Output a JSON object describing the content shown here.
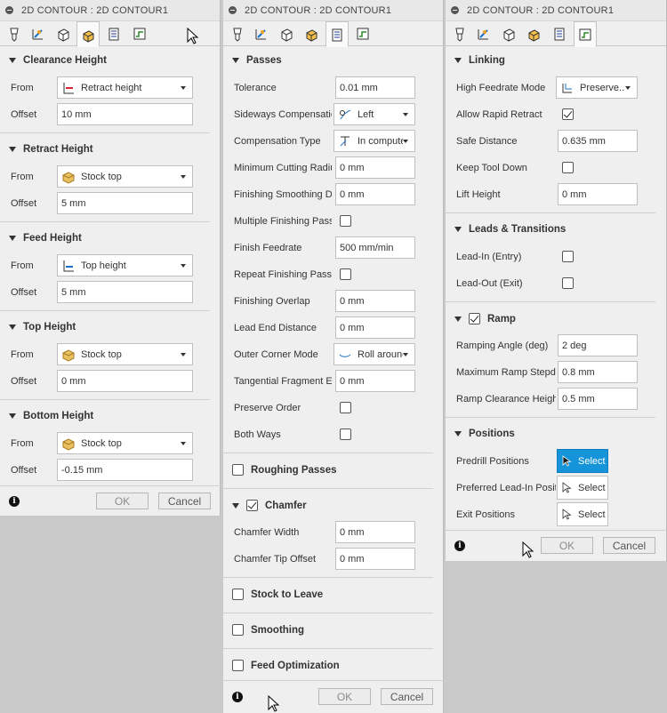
{
  "title": "2D CONTOUR : 2D CONTOUR1",
  "footer": {
    "info": "i",
    "ok": "OK",
    "cancel": "Cancel"
  },
  "panel1": {
    "clearance": {
      "head": "Clearance Height",
      "from_label": "From",
      "from_value": "Retract height",
      "offset_label": "Offset",
      "offset_value": "10 mm"
    },
    "retract": {
      "head": "Retract Height",
      "from_label": "From",
      "from_value": "Stock top",
      "offset_label": "Offset",
      "offset_value": "5 mm"
    },
    "feed": {
      "head": "Feed Height",
      "from_label": "From",
      "from_value": "Top height",
      "offset_label": "Offset",
      "offset_value": "5 mm"
    },
    "top": {
      "head": "Top Height",
      "from_label": "From",
      "from_value": "Stock top",
      "offset_label": "Offset",
      "offset_value": "0 mm"
    },
    "bottom": {
      "head": "Bottom Height",
      "from_label": "From",
      "from_value": "Stock top",
      "offset_label": "Offset",
      "offset_value": "-0.15 mm"
    }
  },
  "panel2": {
    "passes_head": "Passes",
    "tolerance": {
      "label": "Tolerance",
      "value": "0.01 mm"
    },
    "sideways": {
      "label": "Sideways Compensation",
      "value": "Left"
    },
    "comp_type": {
      "label": "Compensation Type",
      "value": "In computer"
    },
    "min_rad": {
      "label": "Minimum Cutting Radius",
      "value": "0 mm"
    },
    "fin_smooth": {
      "label": "Finishing Smoothing Deviation",
      "value": "0 mm"
    },
    "multi_fin": {
      "label": "Multiple Finishing Passes",
      "checked": false
    },
    "fin_feed": {
      "label": "Finish Feedrate",
      "value": "500 mm/min"
    },
    "repeat_fin": {
      "label": "Repeat Finishing Pass",
      "checked": false
    },
    "fin_overlap": {
      "label": "Finishing Overlap",
      "value": "0 mm"
    },
    "lead_end": {
      "label": "Lead End Distance",
      "value": "0 mm"
    },
    "outer_corner": {
      "label": "Outer Corner Mode",
      "value": "Roll around"
    },
    "tangential": {
      "label": "Tangential Fragment Extension",
      "value": "0 mm"
    },
    "preserve": {
      "label": "Preserve Order",
      "checked": false
    },
    "both_ways": {
      "label": "Both Ways",
      "checked": false
    },
    "roughing_head": "Roughing Passes",
    "chamfer_head": "Chamfer",
    "chamfer_width": {
      "label": "Chamfer Width",
      "value": "0 mm"
    },
    "chamfer_tip": {
      "label": "Chamfer Tip Offset",
      "value": "0 mm"
    },
    "stock_head": "Stock to Leave",
    "smoothing_head": "Smoothing",
    "feedopt_head": "Feed Optimization"
  },
  "panel3": {
    "linking_head": "Linking",
    "high_feed": {
      "label": "High Feedrate Mode",
      "value": "Preserve..."
    },
    "allow_rapid": {
      "label": "Allow Rapid Retract",
      "checked": true
    },
    "safe_dist": {
      "label": "Safe Distance",
      "value": "0.635 mm"
    },
    "keep_down": {
      "label": "Keep Tool Down",
      "checked": false
    },
    "lift": {
      "label": "Lift Height",
      "value": "0 mm"
    },
    "leads_head": "Leads & Transitions",
    "lead_in": {
      "label": "Lead-In (Entry)",
      "checked": false
    },
    "lead_out": {
      "label": "Lead-Out (Exit)",
      "checked": false
    },
    "ramp_head": "Ramp",
    "ramp_angle": {
      "label": "Ramping Angle (deg)",
      "value": "2 deg"
    },
    "max_ramp": {
      "label": "Maximum Ramp Stepdown",
      "value": "0.8 mm"
    },
    "ramp_clear": {
      "label": "Ramp Clearance Height",
      "value": "0.5 mm"
    },
    "positions_head": "Positions",
    "predrill": {
      "label": "Predrill Positions",
      "button": "Select"
    },
    "pref_lead": {
      "label": "Preferred Lead-In Positions",
      "button": "Select"
    },
    "exit": {
      "label": "Exit Positions",
      "button": "Select"
    }
  },
  "colors": {
    "select_active": "#1594d9",
    "panel_bg": "#efefef",
    "desktop": "#c9c9c9"
  }
}
